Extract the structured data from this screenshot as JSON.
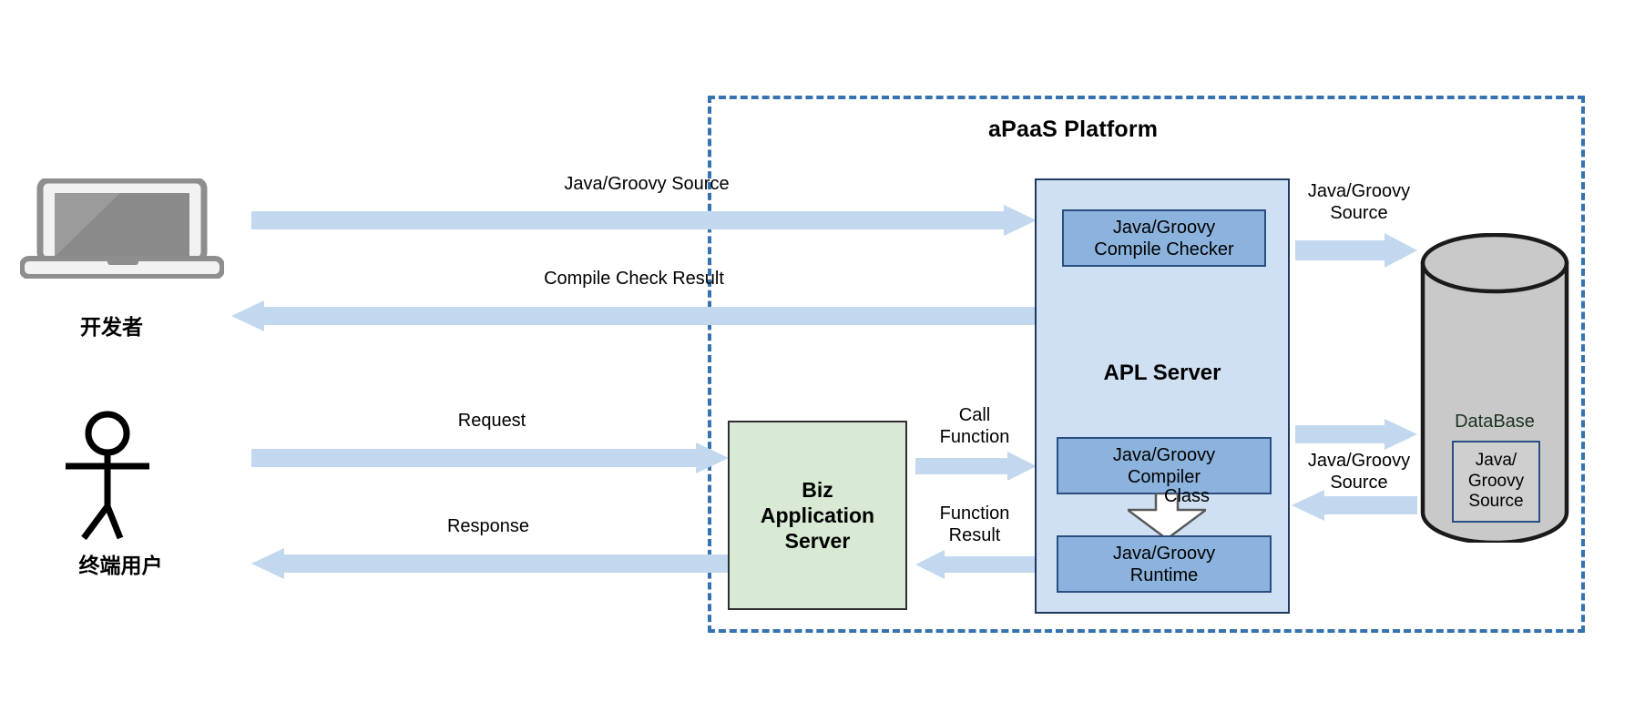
{
  "diagram": {
    "title": "aPaaS  Platform",
    "colors": {
      "platform_border": "#3572b0",
      "arrow_fill": "#c2d8ef",
      "apl_outer_fill": "#cfe0f3",
      "apl_outer_border": "#1f3864",
      "apl_inner_fill": "#8cb3dd",
      "apl_inner_border": "#2b4f81",
      "biz_fill": "#d8ead3",
      "biz_border": "#2e2e2e",
      "db_fill": "#c9c9c9",
      "db_border": "#1a1a1a",
      "db_label_color": "#1b3320",
      "laptop_frame": "#8e8e8e",
      "laptop_screen": "#868686",
      "text": "#000000"
    }
  },
  "actors": {
    "developer": {
      "label": "开发者",
      "icon": "laptop-icon"
    },
    "end_user": {
      "label": "终端用户",
      "icon": "stick-figure-icon"
    }
  },
  "flows": {
    "dev_to_platform": "Java/Groovy Source",
    "platform_to_dev": "Compile Check Result",
    "user_to_biz": "Request",
    "biz_to_user": "Response",
    "biz_to_apl": "Call\nFunction",
    "apl_to_biz": "Function\nResult",
    "checker_to_db": "Java/Groovy\nSource",
    "apl_db_bidirectional": "Java/Groovy\nSource"
  },
  "apl_server": {
    "title": "APL Server",
    "compile_checker": "Java/Groovy\nCompile Checker",
    "compiler": "Java/Groovy\nCompiler",
    "runtime": "Java/Groovy\nRuntime",
    "class_arrow_label": "Class"
  },
  "biz_server": {
    "title": "Biz\nApplication\nServer"
  },
  "database": {
    "title": "DataBase",
    "stored_artifact": "Java/\nGroovy\nSource"
  }
}
